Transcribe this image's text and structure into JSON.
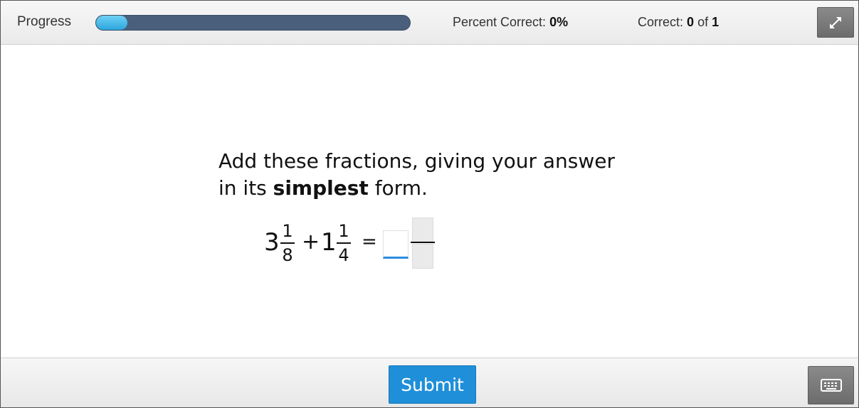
{
  "header": {
    "progress_label": "Progress",
    "progress_fraction": 0.1,
    "percent_correct_label": "Percent Correct:",
    "percent_correct_value": "0%",
    "correct_label": "Correct:",
    "correct_count": "0",
    "correct_of": "of",
    "correct_total": "1",
    "fullscreen_icon": "expand-arrows-icon"
  },
  "question": {
    "line1": "Add these fractions, giving your answer",
    "line2_prefix": "in its ",
    "line2_bold": "simplest",
    "line2_suffix": " form."
  },
  "equation": {
    "term1_whole": "3",
    "term1_num": "1",
    "term1_den": "8",
    "operator": "+",
    "term2_whole": "1",
    "term2_num": "1",
    "term2_den": "4",
    "equals": "=",
    "answer_whole": "",
    "answer_num": "",
    "answer_den": ""
  },
  "footer": {
    "submit_label": "Submit",
    "keyboard_icon": "keyboard-icon"
  },
  "colors": {
    "accent": "#1f8fd9",
    "progress_track": "#4a5f7c",
    "progress_fill": "#2ba6dd"
  }
}
